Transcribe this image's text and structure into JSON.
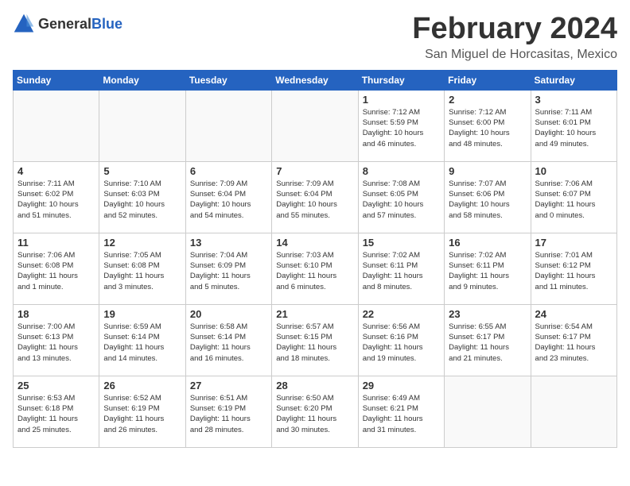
{
  "header": {
    "logo": {
      "text_general": "General",
      "text_blue": "Blue"
    },
    "title": "February 2024",
    "location": "San Miguel de Horcasitas, Mexico"
  },
  "calendar": {
    "weekdays": [
      "Sunday",
      "Monday",
      "Tuesday",
      "Wednesday",
      "Thursday",
      "Friday",
      "Saturday"
    ],
    "weeks": [
      [
        {
          "day": "",
          "info": ""
        },
        {
          "day": "",
          "info": ""
        },
        {
          "day": "",
          "info": ""
        },
        {
          "day": "",
          "info": ""
        },
        {
          "day": "1",
          "info": "Sunrise: 7:12 AM\nSunset: 5:59 PM\nDaylight: 10 hours\nand 46 minutes."
        },
        {
          "day": "2",
          "info": "Sunrise: 7:12 AM\nSunset: 6:00 PM\nDaylight: 10 hours\nand 48 minutes."
        },
        {
          "day": "3",
          "info": "Sunrise: 7:11 AM\nSunset: 6:01 PM\nDaylight: 10 hours\nand 49 minutes."
        }
      ],
      [
        {
          "day": "4",
          "info": "Sunrise: 7:11 AM\nSunset: 6:02 PM\nDaylight: 10 hours\nand 51 minutes."
        },
        {
          "day": "5",
          "info": "Sunrise: 7:10 AM\nSunset: 6:03 PM\nDaylight: 10 hours\nand 52 minutes."
        },
        {
          "day": "6",
          "info": "Sunrise: 7:09 AM\nSunset: 6:04 PM\nDaylight: 10 hours\nand 54 minutes."
        },
        {
          "day": "7",
          "info": "Sunrise: 7:09 AM\nSunset: 6:04 PM\nDaylight: 10 hours\nand 55 minutes."
        },
        {
          "day": "8",
          "info": "Sunrise: 7:08 AM\nSunset: 6:05 PM\nDaylight: 10 hours\nand 57 minutes."
        },
        {
          "day": "9",
          "info": "Sunrise: 7:07 AM\nSunset: 6:06 PM\nDaylight: 10 hours\nand 58 minutes."
        },
        {
          "day": "10",
          "info": "Sunrise: 7:06 AM\nSunset: 6:07 PM\nDaylight: 11 hours\nand 0 minutes."
        }
      ],
      [
        {
          "day": "11",
          "info": "Sunrise: 7:06 AM\nSunset: 6:08 PM\nDaylight: 11 hours\nand 1 minute."
        },
        {
          "day": "12",
          "info": "Sunrise: 7:05 AM\nSunset: 6:08 PM\nDaylight: 11 hours\nand 3 minutes."
        },
        {
          "day": "13",
          "info": "Sunrise: 7:04 AM\nSunset: 6:09 PM\nDaylight: 11 hours\nand 5 minutes."
        },
        {
          "day": "14",
          "info": "Sunrise: 7:03 AM\nSunset: 6:10 PM\nDaylight: 11 hours\nand 6 minutes."
        },
        {
          "day": "15",
          "info": "Sunrise: 7:02 AM\nSunset: 6:11 PM\nDaylight: 11 hours\nand 8 minutes."
        },
        {
          "day": "16",
          "info": "Sunrise: 7:02 AM\nSunset: 6:11 PM\nDaylight: 11 hours\nand 9 minutes."
        },
        {
          "day": "17",
          "info": "Sunrise: 7:01 AM\nSunset: 6:12 PM\nDaylight: 11 hours\nand 11 minutes."
        }
      ],
      [
        {
          "day": "18",
          "info": "Sunrise: 7:00 AM\nSunset: 6:13 PM\nDaylight: 11 hours\nand 13 minutes."
        },
        {
          "day": "19",
          "info": "Sunrise: 6:59 AM\nSunset: 6:14 PM\nDaylight: 11 hours\nand 14 minutes."
        },
        {
          "day": "20",
          "info": "Sunrise: 6:58 AM\nSunset: 6:14 PM\nDaylight: 11 hours\nand 16 minutes."
        },
        {
          "day": "21",
          "info": "Sunrise: 6:57 AM\nSunset: 6:15 PM\nDaylight: 11 hours\nand 18 minutes."
        },
        {
          "day": "22",
          "info": "Sunrise: 6:56 AM\nSunset: 6:16 PM\nDaylight: 11 hours\nand 19 minutes."
        },
        {
          "day": "23",
          "info": "Sunrise: 6:55 AM\nSunset: 6:17 PM\nDaylight: 11 hours\nand 21 minutes."
        },
        {
          "day": "24",
          "info": "Sunrise: 6:54 AM\nSunset: 6:17 PM\nDaylight: 11 hours\nand 23 minutes."
        }
      ],
      [
        {
          "day": "25",
          "info": "Sunrise: 6:53 AM\nSunset: 6:18 PM\nDaylight: 11 hours\nand 25 minutes."
        },
        {
          "day": "26",
          "info": "Sunrise: 6:52 AM\nSunset: 6:19 PM\nDaylight: 11 hours\nand 26 minutes."
        },
        {
          "day": "27",
          "info": "Sunrise: 6:51 AM\nSunset: 6:19 PM\nDaylight: 11 hours\nand 28 minutes."
        },
        {
          "day": "28",
          "info": "Sunrise: 6:50 AM\nSunset: 6:20 PM\nDaylight: 11 hours\nand 30 minutes."
        },
        {
          "day": "29",
          "info": "Sunrise: 6:49 AM\nSunset: 6:21 PM\nDaylight: 11 hours\nand 31 minutes."
        },
        {
          "day": "",
          "info": ""
        },
        {
          "day": "",
          "info": ""
        }
      ]
    ]
  }
}
